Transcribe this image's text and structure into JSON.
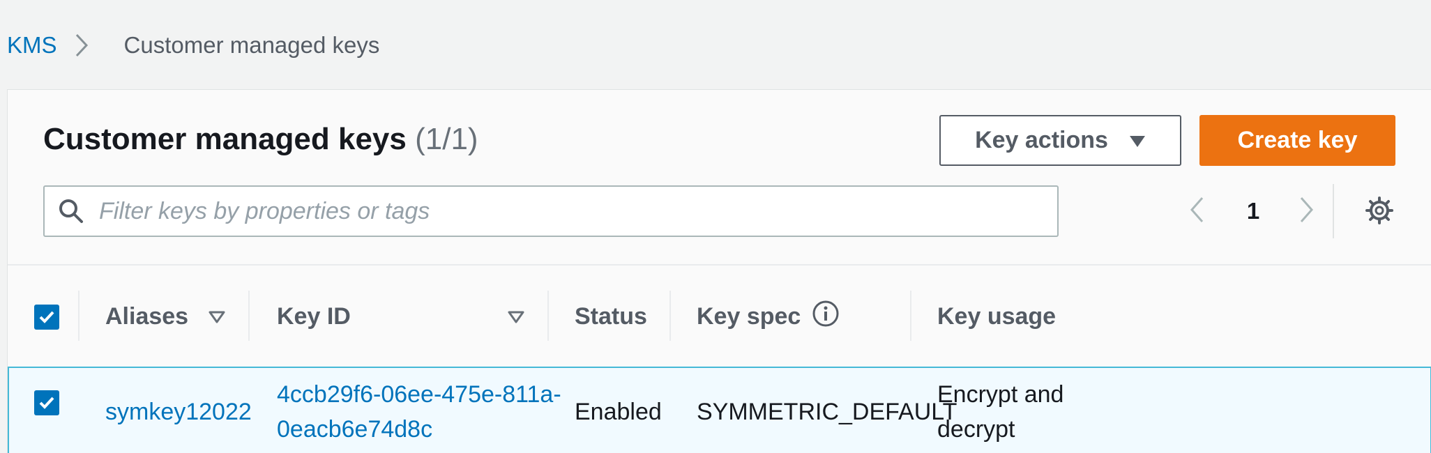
{
  "breadcrumb": {
    "root": "KMS",
    "current": "Customer managed keys"
  },
  "header": {
    "title": "Customer managed keys",
    "count": "(1/1)",
    "actions_label": "Key actions",
    "create_label": "Create key"
  },
  "filter": {
    "placeholder": "Filter keys by properties or tags",
    "value": ""
  },
  "pagination": {
    "current_page": "1"
  },
  "table": {
    "columns": {
      "aliases": "Aliases",
      "key_id": "Key ID",
      "status": "Status",
      "key_spec": "Key spec",
      "key_usage": "Key usage"
    },
    "rows": [
      {
        "selected": true,
        "alias": "symkey12022",
        "key_id_line1": "4ccb29f6-06ee-475e-811a-",
        "key_id_line2": "0eacb6e74d8c",
        "status": "Enabled",
        "key_spec": "SYMMETRIC_DEFAULT",
        "key_usage_line1": "Encrypt and",
        "key_usage_line2": "decrypt"
      }
    ]
  },
  "icons": {
    "breadcrumb_separator": "chevron-right-icon",
    "actions_caret": "caret-down-icon",
    "search": "search-icon",
    "prev": "chevron-left-icon",
    "next": "chevron-right-icon",
    "settings": "gear-icon",
    "sort": "sort-caret-icon",
    "info": "info-icon",
    "checkbox": "checkmark-icon"
  },
  "colors": {
    "link": "#0073bb",
    "primary_button": "#ec7211",
    "selected_row": "#f1faff",
    "selected_border": "#44b9d6",
    "checkbox": "#0073bb"
  }
}
